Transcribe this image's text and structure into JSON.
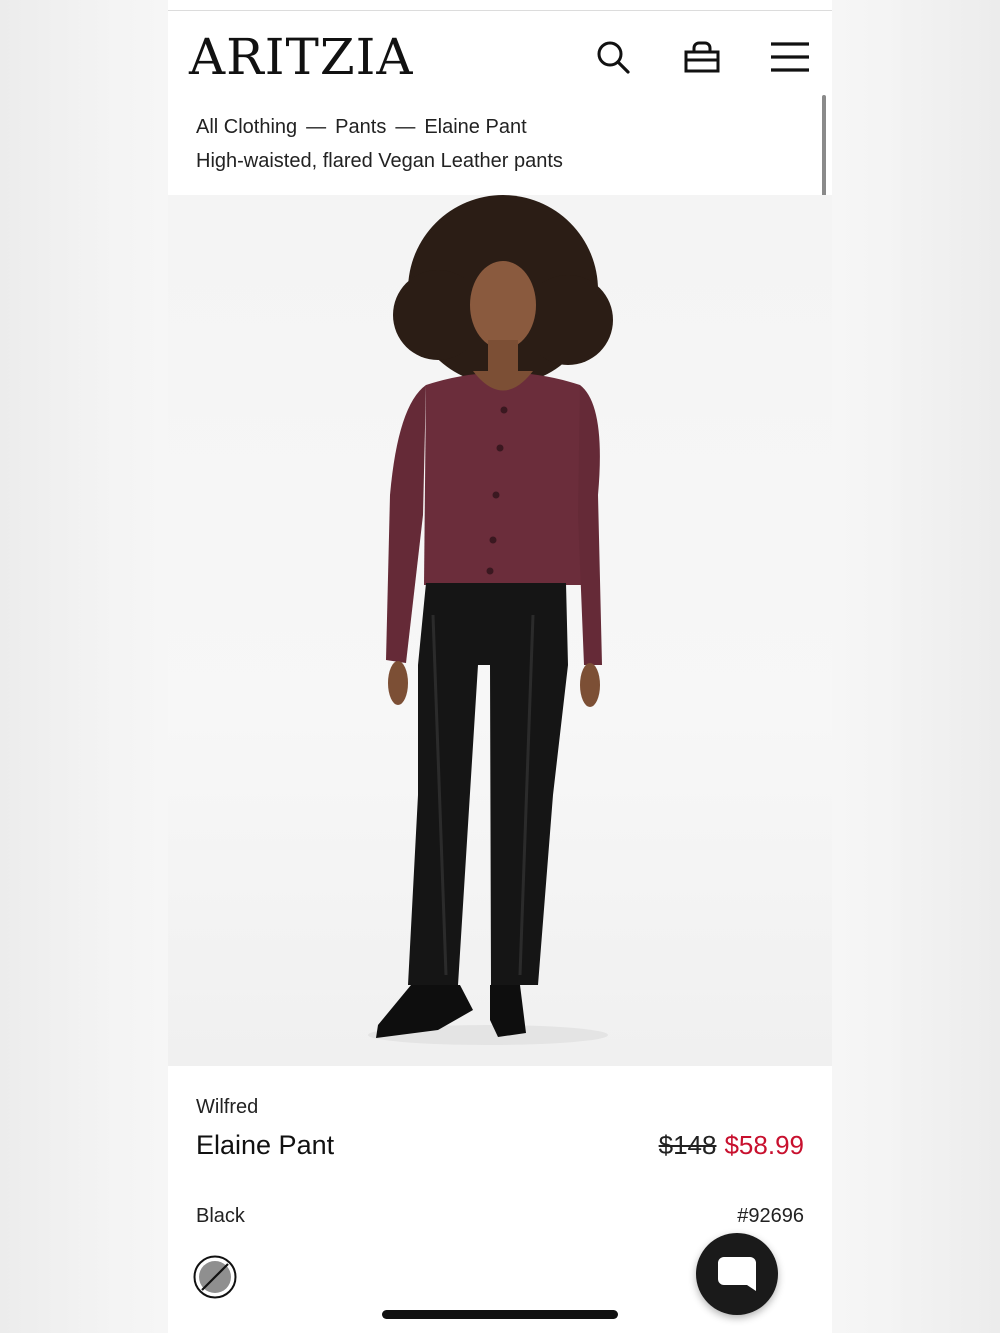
{
  "header": {
    "logo": "ARITZIA",
    "icons": [
      "search-icon",
      "bag-icon",
      "menu-icon"
    ]
  },
  "breadcrumb": {
    "items": [
      "All Clothing",
      "Pants",
      "Elaine Pant"
    ],
    "separator": "—"
  },
  "product": {
    "subtitle": "High-waisted, flared Vegan Leather pants",
    "brand": "Wilfred",
    "name": "Elaine Pant",
    "price_original": "$148",
    "price_sale": "$58.99",
    "color": "Black",
    "style_number": "#92696"
  },
  "colors": {
    "sale": "#c8102e",
    "text": "#111111",
    "cardigan": "#6b2d3b",
    "pants": "#151515"
  }
}
